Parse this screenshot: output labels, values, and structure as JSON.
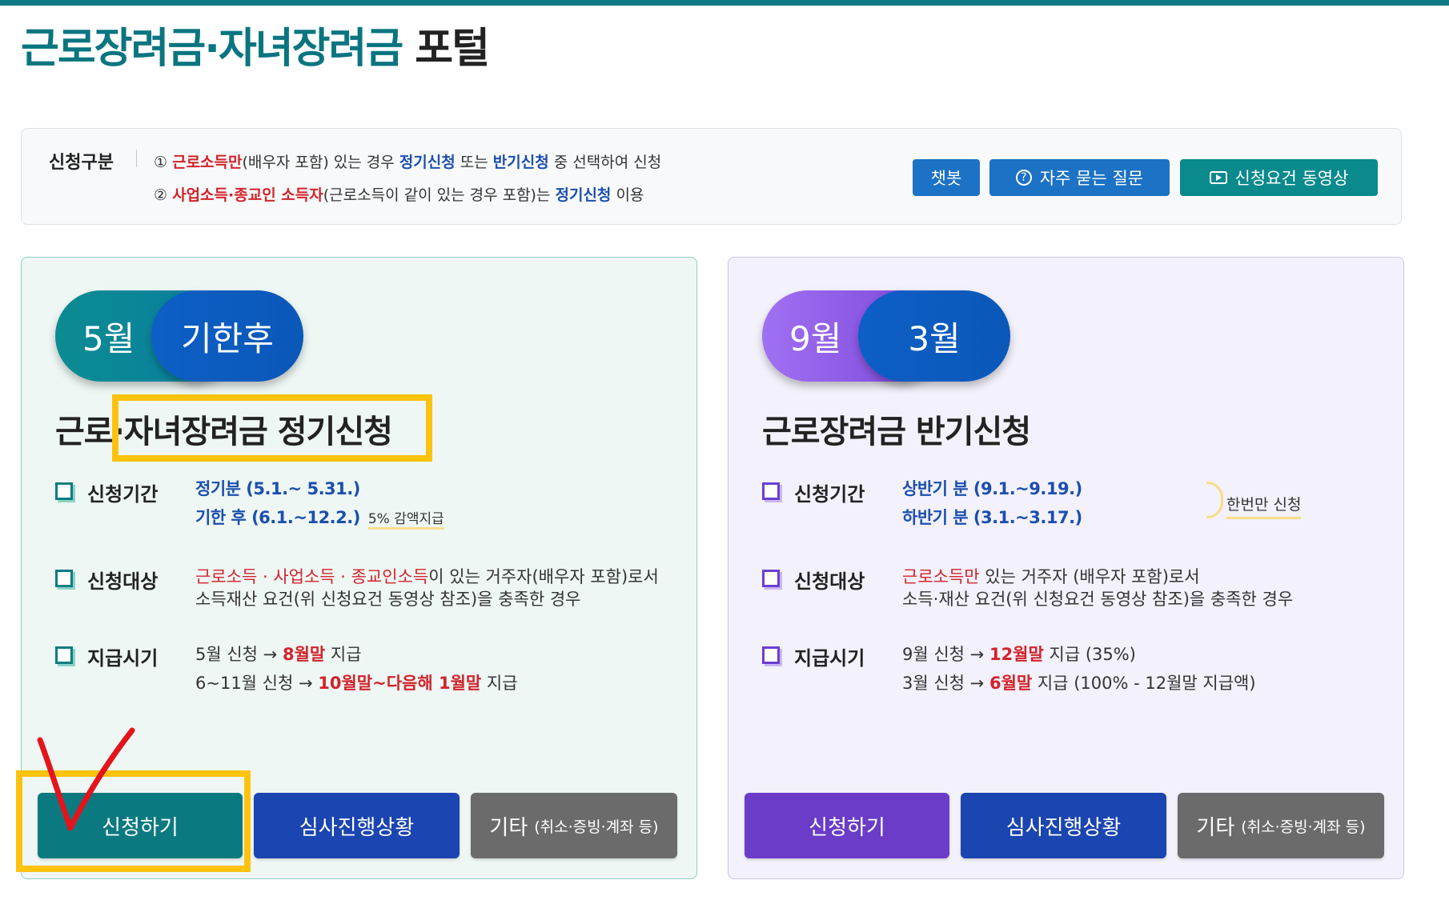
{
  "page": {
    "title_accent": "근로장려금·자녀장려금",
    "title_rest": "포털"
  },
  "notice": {
    "label": "신청구분",
    "line1": {
      "num": "①",
      "red": "근로소득만",
      "t1": "(배우자 포함) 있는 경우 ",
      "blue1": "정기신청",
      "t2": " 또는 ",
      "blue2": "반기신청",
      "t3": " 중 선택하여 신청"
    },
    "line2": {
      "num": "②",
      "red": "사업소득·종교인 소득자",
      "t1": "(근로소득이 같이 있는 경우 포함)는 ",
      "blue1": "정기신청",
      "t2": " 이용"
    },
    "buttons": {
      "chatbot": "챗봇",
      "faq": "자주 묻는 질문",
      "video": "신청요건 동영상"
    }
  },
  "left_card": {
    "pill_a": "5월",
    "pill_b": "기한후",
    "title": "근로·자녀장려금 정기신청",
    "period": {
      "label": "신청기간",
      "line1": "정기분 (5.1.~ 5.31.)",
      "line2": "기한 후 (6.1.~12.2.)",
      "line2_note": "5% 감액지급"
    },
    "target": {
      "label": "신청대상",
      "red": "근로소득 · 사업소득 · 종교인소득",
      "t1": "이 있는 거주자(배우자 포함)로서",
      "line2": "소득재산 요건(위 신청요건 동영상 참조)을 충족한 경우"
    },
    "payment": {
      "label": "지급시기",
      "l1_a": "5월 신청 → ",
      "l1_red": "8월말",
      "l1_b": " 지급",
      "l2_a": "6~11월 신청 → ",
      "l2_red": "10월말~다음해 1월말",
      "l2_b": " 지급"
    },
    "buttons": {
      "apply": "신청하기",
      "status": "심사진행상황",
      "etc": "기타",
      "etc_small": "(취소·증빙·계좌 등)"
    }
  },
  "right_card": {
    "pill_a": "9월",
    "pill_b": "3월",
    "title": "근로장려금 반기신청",
    "period": {
      "label": "신청기간",
      "line1": "상반기 분 (9.1.~9.19.)",
      "line2": "하반기 분 (3.1.~3.17.)",
      "note": "한번만 신청"
    },
    "target": {
      "label": "신청대상",
      "red": "근로소득만",
      "t1": " 있는 거주자 (배우자 포함)로서",
      "line2": "소득·재산 요건(위 신청요건 동영상 참조)을 충족한 경우"
    },
    "payment": {
      "label": "지급시기",
      "l1_a": "9월 신청 → ",
      "l1_red": "12월말",
      "l1_b": " 지급 (35%)",
      "l2_a": "3월 신청 → ",
      "l2_red": "6월말",
      "l2_b": " 지급 (100% - 12월말 지급액)"
    },
    "buttons": {
      "apply": "신청하기",
      "status": "심사진행상황",
      "etc": "기타",
      "etc_small": "(취소·증빙·계좌 등)"
    }
  },
  "colors": {
    "teal": "#0b7a80",
    "navy": "#1b45b0",
    "purple": "#6a3cc8",
    "gray": "#6b6b6b",
    "annotation_yellow": "#ffc20e",
    "annotation_red": "#e3141b"
  }
}
